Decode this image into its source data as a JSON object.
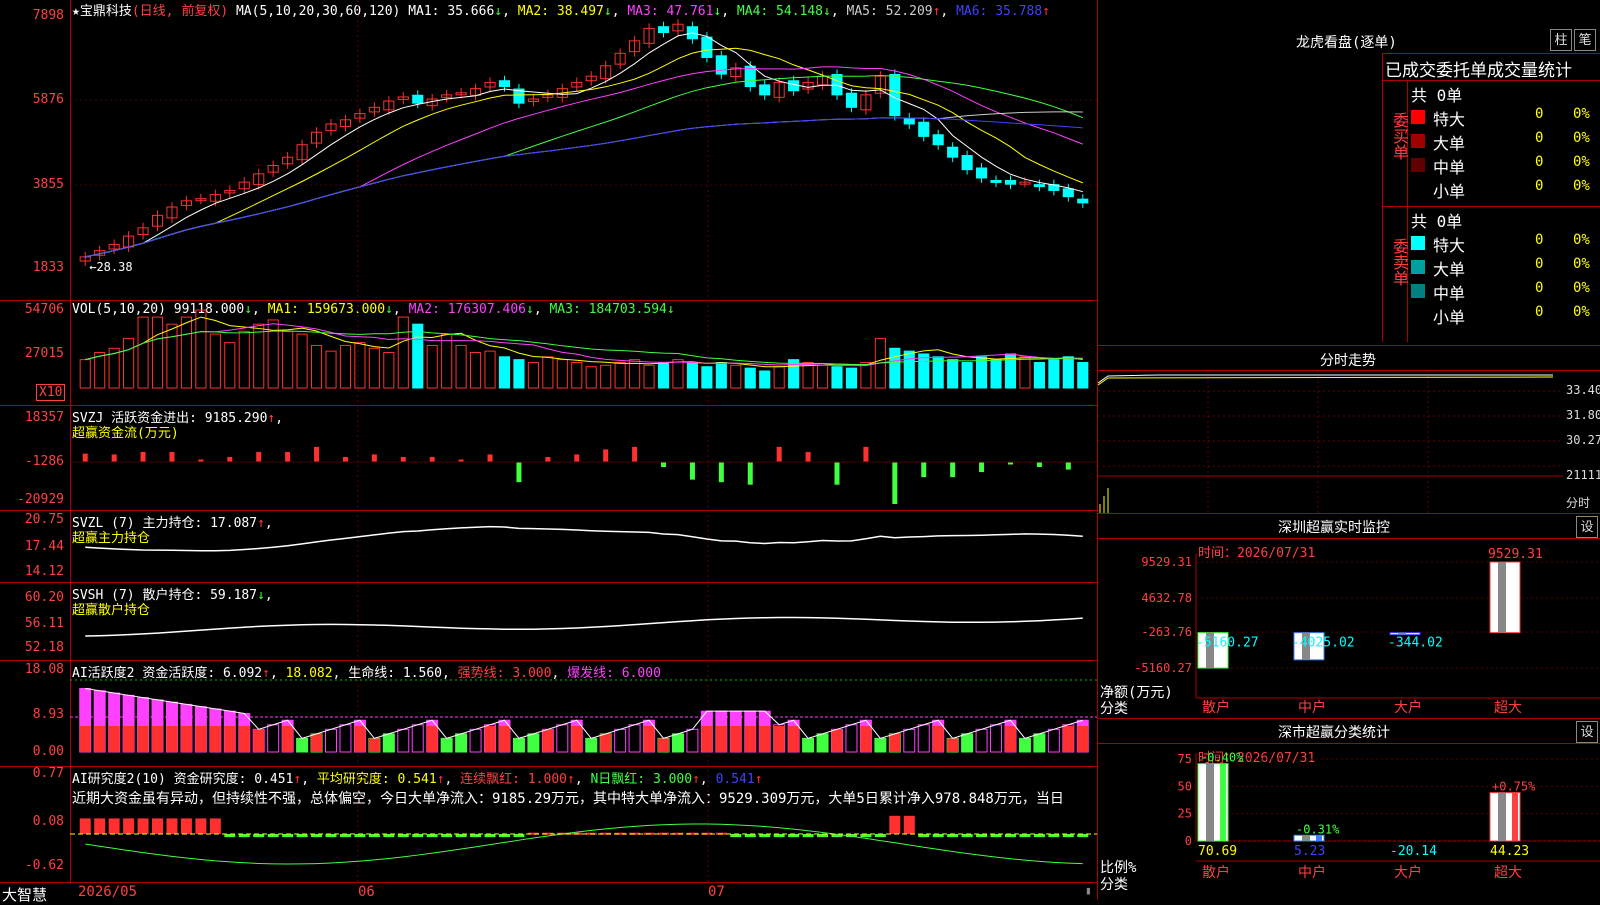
{
  "chart_data": [
    {
      "type": "candlestick",
      "title": "宝鼎科技",
      "subtitle": "(日线, 前复权)",
      "ma_header": "MA(5,10,20,30,60,120)",
      "ma": [
        {
          "name": "MA1",
          "value": "35.666",
          "arrow": "↓",
          "color": "#ffffff"
        },
        {
          "name": "MA2",
          "value": "38.497",
          "arrow": "↓",
          "color": "#ffff00"
        },
        {
          "name": "MA3",
          "value": "47.761",
          "arrow": "↓",
          "color": "#ff40ff"
        },
        {
          "name": "MA4",
          "value": "54.148",
          "arrow": "↓",
          "color": "#40ff40"
        },
        {
          "name": "MA5",
          "value": "52.209",
          "arrow": "↑",
          "color": "#cccccc"
        },
        {
          "name": "MA6",
          "value": "35.788",
          "arrow": "↑",
          "color": "#4040ff"
        }
      ],
      "y_ticks": [
        "7898",
        "5876",
        "3855",
        "1833"
      ],
      "ylim": [
        1833,
        7898
      ],
      "high_label": "78.98",
      "low_label": "28.38",
      "closes": [
        2100,
        2250,
        2400,
        2600,
        2800,
        3100,
        3300,
        3450,
        3500,
        3600,
        3700,
        3900,
        4100,
        4300,
        4500,
        4800,
        5100,
        5300,
        5400,
        5550,
        5700,
        5850,
        5950,
        5800,
        5900,
        6000,
        6050,
        6150,
        6300,
        6200,
        5800,
        5900,
        6000,
        6150,
        6300,
        6450,
        6700,
        7000,
        7300,
        7600,
        7500,
        7700,
        7350,
        6900,
        6500,
        6650,
        6200,
        6000,
        6300,
        6100,
        6300,
        6450,
        6000,
        5700,
        6000,
        6450,
        5500,
        5300,
        5000,
        4800,
        4500,
        4200,
        4000,
        3900,
        3850,
        3900,
        3800,
        3700,
        3550,
        3400
      ]
    },
    {
      "type": "bar",
      "name": "VOL",
      "header": "VOL(5,10,20)",
      "value": "99118.000",
      "ma": [
        {
          "name": "MA1",
          "value": "159673.000",
          "arrow": "↓",
          "color": "#ffff00"
        },
        {
          "name": "MA2",
          "value": "176307.406",
          "arrow": "↓",
          "color": "#ff40ff"
        },
        {
          "name": "MA3",
          "value": "184703.594",
          "arrow": "↓",
          "color": "#40ff40"
        }
      ],
      "y_ticks": [
        "54706",
        "27015"
      ],
      "unit_label": "X10",
      "values": [
        20,
        25,
        28,
        35,
        50,
        50,
        45,
        50,
        55,
        38,
        32,
        40,
        45,
        48,
        40,
        38,
        30,
        26,
        30,
        32,
        28,
        25,
        50,
        45,
        30,
        38,
        30,
        25,
        26,
        22,
        20,
        18,
        22,
        20,
        18,
        15,
        16,
        18,
        20,
        16,
        18,
        20,
        18,
        15,
        18,
        16,
        14,
        12,
        15,
        20,
        18,
        16,
        15,
        14,
        18,
        35,
        28,
        26,
        24,
        22,
        20,
        18,
        22,
        20,
        24,
        22,
        18,
        20,
        22,
        18
      ]
    },
    {
      "type": "bar",
      "name": "SVZJ",
      "header": "SVZJ",
      "subheader": "活跃资金进出:",
      "value": "9185.290",
      "arrow": "↑",
      "sublabel": "超赢资金流(万元)",
      "y_ticks": [
        "18357",
        "-1286",
        "-20929"
      ],
      "ylim": [
        -20929,
        18357
      ]
    },
    {
      "type": "line",
      "name": "SVZL",
      "header": "SVZL (7)",
      "subheader": "主力持仓:",
      "value": "17.087",
      "arrow": "↑",
      "sublabel": "超赢主力持仓",
      "y_ticks": [
        "20.75",
        "17.44",
        "14.12"
      ],
      "ylim": [
        14.12,
        20.75
      ]
    },
    {
      "type": "line",
      "name": "SVSH",
      "header": "SVSH (7)",
      "subheader": "散户持仓:",
      "value": "59.187",
      "arrow": "↓",
      "sublabel": "超赢散户持仓",
      "y_ticks": [
        "60.20",
        "56.11",
        "52.18"
      ],
      "ylim": [
        52.18,
        60.2
      ]
    },
    {
      "type": "bar",
      "name": "AI活跃度2",
      "header": "AI活跃度2",
      "items": [
        {
          "label": "资金活跃度:",
          "value": "6.092",
          "arrow": "↑",
          "color": "#ffffff"
        },
        {
          "label": "",
          "value": "18.082",
          "arrow": "",
          "color": "#ffff00"
        },
        {
          "label": "生命线:",
          "value": "1.560",
          "arrow": "",
          "color": "#ffffff"
        },
        {
          "label": "强势线:",
          "value": "3.000",
          "arrow": "",
          "color": "#ff4040"
        },
        {
          "label": "爆发线:",
          "value": "6.000",
          "arrow": "",
          "color": "#ff40ff"
        }
      ],
      "y_ticks": [
        "18.08",
        "8.93",
        "0.00"
      ],
      "ylim": [
        0,
        18.08
      ]
    },
    {
      "type": "bar",
      "name": "AI研究度2",
      "header": "AI研究度2(10)",
      "items": [
        {
          "label": "资金研究度:",
          "value": "0.451",
          "arrow": "↑",
          "color": "#ffffff"
        },
        {
          "label": "平均研究度:",
          "value": "0.541",
          "arrow": "↑",
          "color": "#ffff00"
        },
        {
          "label": "连续飘红:",
          "value": "1.000",
          "arrow": "↑",
          "color": "#ff4040"
        },
        {
          "label": "N日飘红:",
          "value": "3.000",
          "arrow": "↑",
          "color": "#40ff40"
        },
        {
          "label": "",
          "value": "0.541",
          "arrow": "↑",
          "color": "#4040ff"
        }
      ],
      "commentary": "近期大资金虽有异动，但持续性不强，总体偏空，今日大单净流入：9185.29万元，其中特大单净流入：9529.309万元，大单5日累计净入978.848万元，当日",
      "y_ticks": [
        "0.77",
        "0.08",
        "-0.62"
      ],
      "ylim": [
        -0.62,
        0.77
      ]
    },
    {
      "type": "bar",
      "name": "深圳超赢实时监控",
      "title": "深圳超赢实时监控",
      "time": "时间：2026/07/31",
      "categories": [
        "散户",
        "中户",
        "大户",
        "超大"
      ],
      "values": [
        -5160.27,
        -4025.02,
        -344.02,
        9529.31
      ],
      "value_labels": [
        "-5160.27",
        "-4025.02",
        "-344.02",
        "9529.31"
      ],
      "y_ticks": [
        "9529.31",
        "4632.78",
        "-263.76",
        "-5160.27"
      ],
      "ylim": [
        -5160.27,
        9529.31
      ],
      "ylabel": "净额(万元)",
      "xlabel": "分类"
    },
    {
      "type": "bar",
      "name": "深市超赢分类统计",
      "title": "深市超赢分类统计",
      "time": "时间：2026/07/31",
      "categories": [
        "散户",
        "中户",
        "大户",
        "超大"
      ],
      "values": [
        70.69,
        5.23,
        -20.14,
        44.23
      ],
      "value_labels": [
        "70.69",
        "5.23",
        "-20.14",
        "44.23"
      ],
      "change_labels": [
        "-0.40%",
        "-0.31%",
        "",
        "+0.75%"
      ],
      "y_ticks": [
        "75",
        "50",
        "25",
        "0"
      ],
      "ylim": [
        0,
        75
      ],
      "ylabel": "比例%",
      "xlabel": "分类"
    }
  ],
  "x_axis": {
    "labels": [
      "2026/05",
      "06",
      "07"
    ]
  },
  "app_name": "大智慧",
  "longhu": {
    "title": "龙虎看盘(逐单)",
    "btn_bar": "柱",
    "btn_pen": "笔",
    "table_title": "已成交委托单成交量统计",
    "buy_label": "委买单",
    "sell_label": "委卖单",
    "buy_total": "共 0单",
    "sell_total": "共 0单",
    "buy_rows": [
      {
        "name": "特大",
        "vol": "0",
        "pct": "0%",
        "color": "#ff0000"
      },
      {
        "name": "大单",
        "vol": "0",
        "pct": "0%",
        "color": "#a00000"
      },
      {
        "name": "中单",
        "vol": "0",
        "pct": "0%",
        "color": "#600000"
      },
      {
        "name": "小单",
        "vol": "0",
        "pct": "0%",
        "color": ""
      }
    ],
    "sell_rows": [
      {
        "name": "特大",
        "vol": "0",
        "pct": "0%",
        "color": "#00ffff"
      },
      {
        "name": "大单",
        "vol": "0",
        "pct": "0%",
        "color": "#00a0a0"
      },
      {
        "name": "中单",
        "vol": "0",
        "pct": "0%",
        "color": "#008080"
      },
      {
        "name": "小单",
        "vol": "0",
        "pct": "0%",
        "color": ""
      }
    ]
  },
  "intraday": {
    "title": "分时走势",
    "y_ticks": [
      "33.40",
      "31.80",
      "30.27",
      "21111"
    ],
    "foot_label": "分时"
  },
  "set_button": "设",
  "colors": {
    "up": "#ff3030",
    "down": "#00ffff",
    "grid": "#a00000"
  }
}
